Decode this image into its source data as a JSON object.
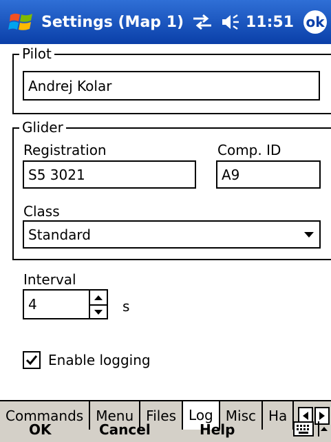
{
  "titlebar": {
    "title": "Settings (Map 1)",
    "clock": "11:51",
    "ok_label": "ok"
  },
  "pilot": {
    "legend": "Pilot",
    "name_value": "Andrej Kolar"
  },
  "glider": {
    "legend": "Glider",
    "registration_label": "Registration",
    "registration_value": "S5 3021",
    "comp_id_label": "Comp. ID",
    "comp_id_value": "A9",
    "class_label": "Class",
    "class_value": "Standard"
  },
  "interval": {
    "label": "Interval",
    "value": "4",
    "unit": "s"
  },
  "logging": {
    "label": "Enable logging",
    "checked": true
  },
  "tabs": [
    {
      "label": "Commands",
      "active": false
    },
    {
      "label": "Menu",
      "active": false
    },
    {
      "label": "Files",
      "active": false
    },
    {
      "label": "Log",
      "active": true
    },
    {
      "label": "Misc",
      "active": false
    },
    {
      "label": "Ha",
      "active": false
    }
  ],
  "menubar": {
    "ok": "OK",
    "cancel": "Cancel",
    "help": "Help"
  }
}
